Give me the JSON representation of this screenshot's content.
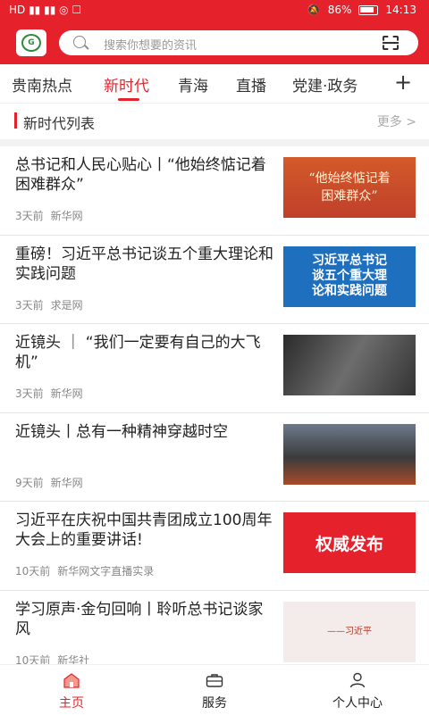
{
  "status_bar": {
    "left": "HD ▮▮ ▮▮ ◎ ☐",
    "battery": "86%",
    "time": "14:13"
  },
  "header": {
    "search_placeholder": "搜索你想要的资讯"
  },
  "tabs": [
    {
      "label": "贵南热点",
      "active": false
    },
    {
      "label": "新时代",
      "active": true
    },
    {
      "label": "青海",
      "active": false
    },
    {
      "label": "直播",
      "active": false
    },
    {
      "label": "党建·政务",
      "active": false
    }
  ],
  "tab_plus": "+",
  "section": {
    "title": "新时代列表",
    "more": "更多 >"
  },
  "news": [
    {
      "title": "总书记和人民心贴心丨“他始终惦记着困难群众”",
      "time": "3天前",
      "source": "新华网",
      "thumb_text": "“他始终惦记着\n困难群众”"
    },
    {
      "title": "重磅！习近平总书记谈五个重大理论和实践问题",
      "time": "3天前",
      "source": "求是网",
      "thumb_text": "习近平总书记\n谈五个重大理\n论和实践问题"
    },
    {
      "title": "近镜头 ｜ “我们一定要有自己的大飞机”",
      "time": "3天前",
      "source": "新华网",
      "thumb_text": ""
    },
    {
      "title": "近镜头丨总有一种精神穿越时空",
      "time": "9天前",
      "source": "新华网",
      "thumb_text": ""
    },
    {
      "title": "习近平在庆祝中国共青团成立100周年大会上的重要讲话!",
      "time": "10天前",
      "source": "新华网文字直播实录",
      "thumb_text": "权威发布"
    },
    {
      "title": "学习原声·金句回响丨聆听总书记谈家风",
      "time": "10天前",
      "source": "新华社",
      "thumb_text": "——习近平"
    }
  ],
  "bottom_nav": [
    {
      "label": "主页",
      "icon": "home-icon",
      "active": true
    },
    {
      "label": "服务",
      "icon": "briefcase-icon",
      "active": false
    },
    {
      "label": "个人中心",
      "icon": "user-icon",
      "active": false
    }
  ],
  "colors": {
    "brand_red": "#e5222c"
  }
}
